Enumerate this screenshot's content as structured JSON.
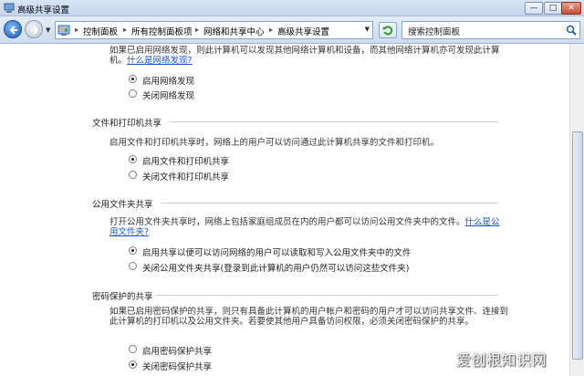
{
  "window": {
    "title": "高级共享设置",
    "buttons": {
      "minimize": "—",
      "maximize": "□",
      "close": "✕"
    }
  },
  "nav": {
    "breadcrumb": [
      "控制面板",
      "所有控制面板项",
      "网络和共享中心",
      "高级共享设置"
    ],
    "separator": "▸",
    "search_placeholder": "搜索控制面板"
  },
  "network_discovery": {
    "description": "如果已启用网络发现，则此计算机可以发现其他网络计算机和设备，而其他网络计算机亦可发现此计算机。",
    "link": "什么是网络发现?",
    "options": [
      {
        "label": "启用网络发现",
        "selected": true
      },
      {
        "label": "关闭网络发现",
        "selected": false
      }
    ]
  },
  "file_printer": {
    "heading": "文件和打印机共享",
    "description": "启用文件和打印机共享时，网络上的用户可以访问通过此计算机共享的文件和打印机。",
    "options": [
      {
        "label": "启用文件和打印机共享",
        "selected": true
      },
      {
        "label": "关闭文件和打印机共享",
        "selected": false
      }
    ]
  },
  "public_folder": {
    "heading": "公用文件夹共享",
    "description": "打开公用文件夹共享时，网络上包括家庭组成员在内的用户都可以访问公用文件夹中的文件。",
    "link": "什么是公用文件夹?",
    "options": [
      {
        "label": "启用共享以便可以访问网络的用户可以读取和写入公用文件夹中的文件",
        "selected": true
      },
      {
        "label": "关闭公用文件夹共享(登录到此计算机的用户仍然可以访问这些文件夹)",
        "selected": false
      }
    ]
  },
  "password_protection": {
    "heading": "密码保护的共享",
    "description": "如果已启用密码保护的共享，则只有具备此计算机的用户帐户和密码的用户才可以访问共享文件、连接到此计算机的打印机以及公用文件夹。若要使其他用户具备访问权限，必须关闭密码保护的共享。",
    "options": [
      {
        "label": "启用密码保护共享",
        "selected": false
      },
      {
        "label": "关闭密码保护共享",
        "selected": true
      }
    ]
  },
  "watermark": "爱创根知识网"
}
